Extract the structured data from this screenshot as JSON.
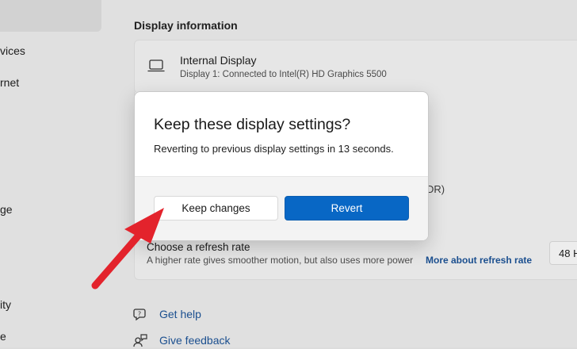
{
  "sidebar": {
    "items": [
      {
        "label": "vices"
      },
      {
        "label": "rnet"
      },
      {
        "label": "ge"
      },
      {
        "label": "ity"
      },
      {
        "label": "e"
      }
    ]
  },
  "display_info": {
    "section_title": "Display information",
    "display_name": "Internal Display",
    "display_description": "Display 1: Connected to Intel(R) HD Graphics 5500",
    "hidden_fragment": "DR)"
  },
  "refresh_rate": {
    "title": "Choose a refresh rate",
    "description": "A higher rate gives smoother motion, but also uses more power",
    "link": "More about refresh rate",
    "selected_value": "48 H"
  },
  "help": {
    "get_help": "Get help",
    "give_feedback": "Give feedback"
  },
  "dialog": {
    "title": "Keep these display settings?",
    "message": "Reverting to previous display settings in 13 seconds.",
    "keep_label": "Keep changes",
    "revert_label": "Revert"
  },
  "colors": {
    "accent": "#0867c5",
    "link": "#1b4f8f",
    "annotation_arrow": "#e3232c"
  }
}
